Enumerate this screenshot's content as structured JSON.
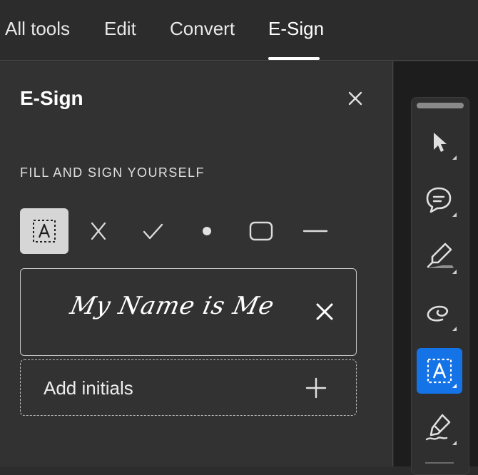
{
  "topbar": {
    "tabs": [
      {
        "label": "All tools"
      },
      {
        "label": "Edit"
      },
      {
        "label": "Convert"
      },
      {
        "label": "E-Sign",
        "active": true
      }
    ]
  },
  "panel": {
    "title": "E-Sign",
    "section_label": "FILL AND SIGN YOURSELF",
    "tools": [
      {
        "icon": "text-field-icon",
        "selected": true
      },
      {
        "icon": "cross-mark-icon"
      },
      {
        "icon": "checkmark-icon"
      },
      {
        "icon": "dot-icon"
      },
      {
        "icon": "rounded-rectangle-icon"
      },
      {
        "icon": "line-icon"
      }
    ],
    "signature": {
      "text": "My Name is Me"
    },
    "initials": {
      "label": "Add initials"
    }
  },
  "rail": {
    "tools": [
      {
        "icon": "select-pointer-icon"
      },
      {
        "icon": "comment-icon"
      },
      {
        "icon": "highlight-pen-icon"
      },
      {
        "icon": "draw-freehand-icon"
      },
      {
        "icon": "text-field-icon",
        "active": true
      },
      {
        "icon": "signature-pen-icon"
      }
    ]
  },
  "colors": {
    "accent": "#1473e6",
    "background": "#2c2c2c",
    "panel": "#323232"
  }
}
